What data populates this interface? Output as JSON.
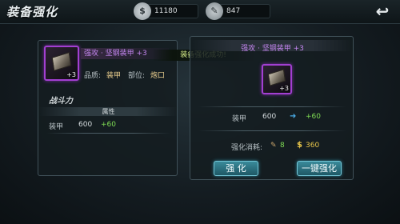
{
  "header": {
    "title": "装备强化",
    "coins": "11180",
    "strengthen_stones": "847",
    "back_icon": "back-arrow-icon"
  },
  "toast": "装备强化成功!",
  "left_panel": {
    "item_level": "+3",
    "item_name": "强攻 · 坚钢装甲 +3",
    "quality_label": "品质:",
    "quality_value": "装甲",
    "slot_label": "部位:",
    "slot_value": "炮口",
    "power_label": "战斗力",
    "attributes_header": "属性",
    "stats": [
      {
        "name": "装甲",
        "value": "600",
        "bonus": "+60"
      }
    ]
  },
  "right_panel": {
    "item_name": "强攻 · 坚钢装甲 +3",
    "item_level": "+3",
    "stat_name": "装甲",
    "stat_value": "600",
    "stat_bonus": "+60",
    "cost_label": "强化消耗:",
    "cost_stones": "8",
    "cost_coins": "360",
    "strengthen_button": "强 化",
    "auto_strengthen_button": "一键强化"
  },
  "colors": {
    "purple_quality": "#c486f0",
    "bonus_green": "#7edc53",
    "button_teal": "#3a8a9a"
  }
}
